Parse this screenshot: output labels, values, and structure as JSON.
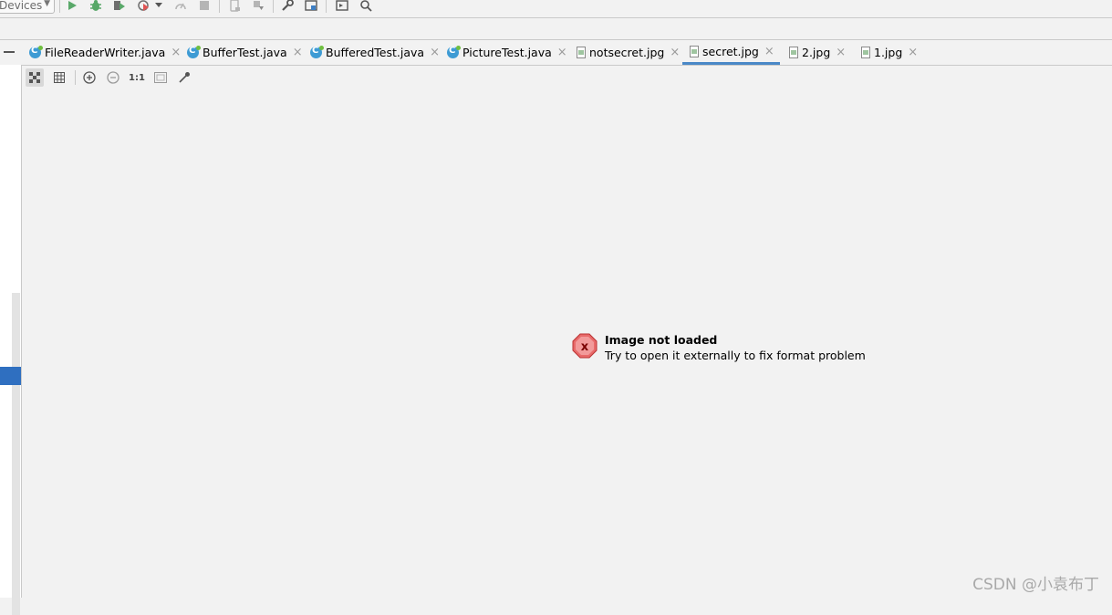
{
  "toolbar": {
    "device_selector": "Devices",
    "icons": [
      "run-icon",
      "debug-icon",
      "coverage-icon",
      "profile-icon",
      "dropdown-arrow-icon",
      "speed-icon",
      "stop-icon",
      "device-manager-icon",
      "sync-icon",
      "wrench-icon",
      "project-structure-icon",
      "terminal-icon",
      "search-icon"
    ]
  },
  "tabs": [
    {
      "label": "FileReaderWriter.java",
      "icon": "java-class-icon"
    },
    {
      "label": "BufferTest.java",
      "icon": "java-class-icon"
    },
    {
      "label": "BufferedTest.java",
      "icon": "java-class-icon"
    },
    {
      "label": "PictureTest.java",
      "icon": "java-class-icon"
    },
    {
      "label": "notsecret.jpg",
      "icon": "image-file-icon"
    },
    {
      "label": "secret.jpg",
      "icon": "image-file-icon",
      "active": true
    },
    {
      "label": "2.jpg",
      "icon": "image-file-icon"
    },
    {
      "label": "1.jpg",
      "icon": "image-file-icon"
    }
  ],
  "tab_close_glyph": "×",
  "image_toolbar": {
    "ratio_label": "1:1",
    "icons": [
      "chessboard-icon",
      "grid-icon",
      "zoom-in-icon",
      "zoom-out-icon",
      "actual-size-icon",
      "fit-window-icon",
      "color-picker-icon"
    ]
  },
  "message": {
    "title": "Image not loaded",
    "subtitle": "Try to open it externally to fix format problem",
    "icon": "error-icon",
    "icon_glyph": "x"
  },
  "watermark": "CSDN @小袁布丁",
  "colors": {
    "accent": "#4a88c7",
    "run_green": "#59a869",
    "error_red": "#e05555",
    "selection_blue": "#2f6fc0"
  }
}
